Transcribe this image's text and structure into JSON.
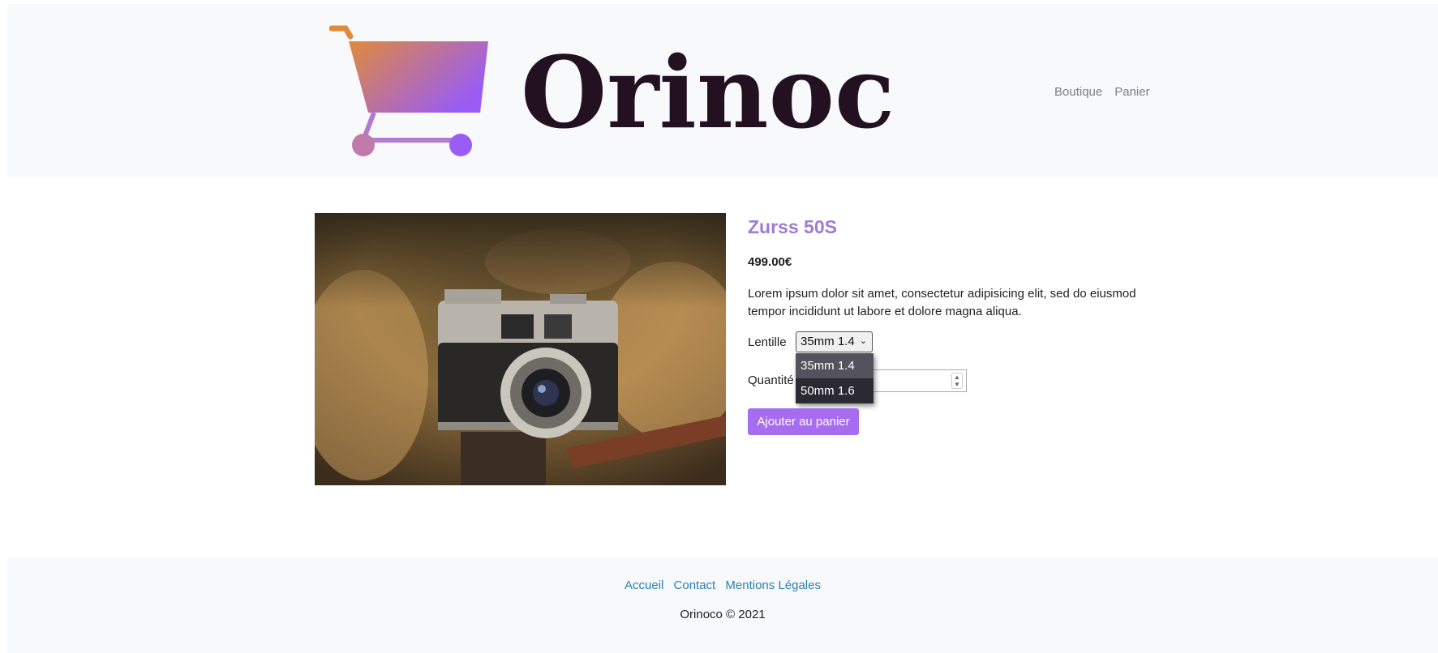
{
  "header": {
    "brand": "Orinoco",
    "nav": [
      "Boutique",
      "Panier"
    ]
  },
  "product": {
    "name": "Zurss 50S",
    "price": "499.00€",
    "description": "Lorem ipsum dolor sit amet, consectetur adipisicing elit, sed do eiusmod tempor incididunt ut labore et dolore magna aliqua.",
    "lens_label": "Lentille",
    "lens_selected": "35mm 1.4",
    "lens_options": [
      "35mm 1.4",
      "50mm 1.6"
    ],
    "quantity_label": "Quantité",
    "add_to_cart": "Ajouter au panier"
  },
  "footer": {
    "links": [
      "Accueil",
      "Contact",
      "Mentions Légales"
    ],
    "copyright": "Orinoco © 2021"
  },
  "colors": {
    "accent": "#a76df0",
    "title": "#a17ad3",
    "link": "#2a7fb5",
    "dropdown_bg": "#2b2a33"
  }
}
